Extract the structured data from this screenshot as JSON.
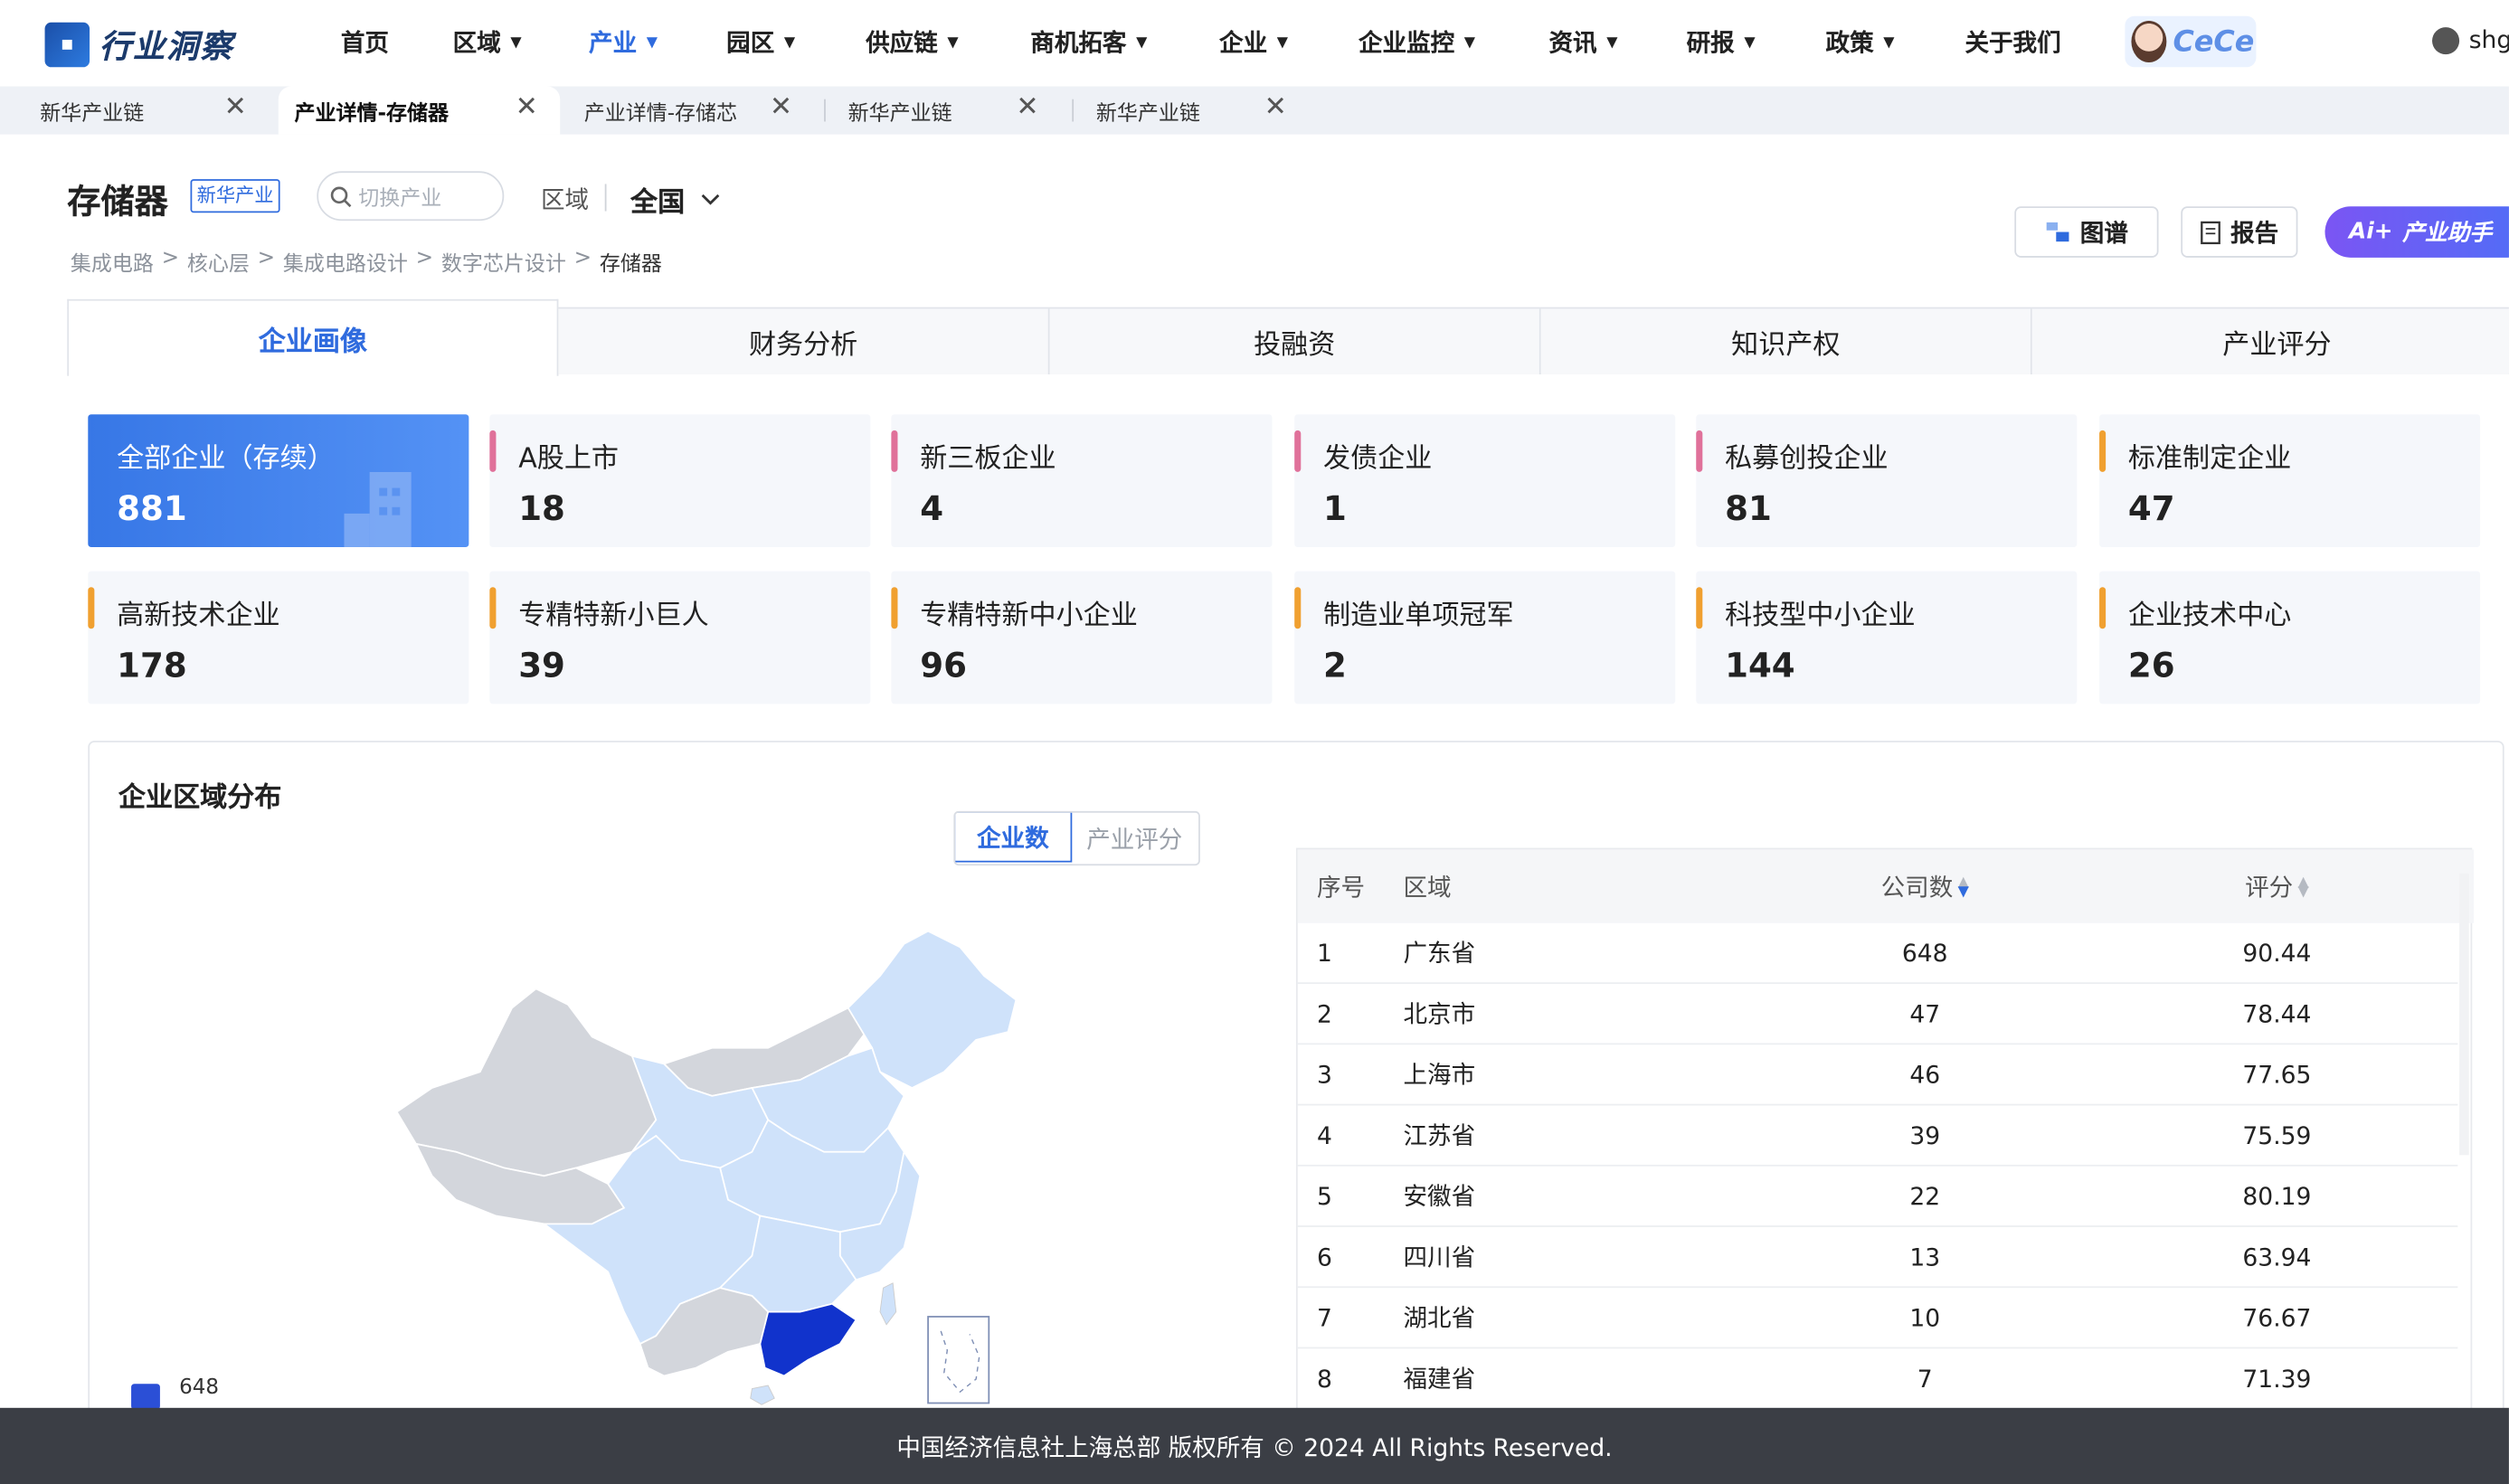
{
  "nav": {
    "logo_text": "行业洞察",
    "items": [
      {
        "label": "首页",
        "dropdown": false
      },
      {
        "label": "区域",
        "dropdown": true
      },
      {
        "label": "产业",
        "dropdown": true
      },
      {
        "label": "园区",
        "dropdown": true
      },
      {
        "label": "供应链",
        "dropdown": true
      },
      {
        "label": "商机拓客",
        "dropdown": true
      },
      {
        "label": "企业",
        "dropdown": true
      },
      {
        "label": "企业监控",
        "dropdown": true
      },
      {
        "label": "资讯",
        "dropdown": true
      },
      {
        "label": "研报",
        "dropdown": true
      },
      {
        "label": "政策",
        "dropdown": true
      },
      {
        "label": "关于我们",
        "dropdown": false
      }
    ],
    "assistant": "CeCe",
    "user": "shg"
  },
  "tabs": [
    {
      "label": "新华产业链"
    },
    {
      "label": "产业详情-存储器"
    },
    {
      "label": "产业详情-存储芯"
    },
    {
      "label": "新华产业链"
    },
    {
      "label": "新华产业链"
    }
  ],
  "header": {
    "title": "存储器",
    "badge": "新华产业",
    "search_placeholder": "切换产业",
    "region_label": "区域",
    "region_value": "全国",
    "breadcrumb": [
      "集成电路",
      "核心层",
      "集成电路设计",
      "数字芯片设计",
      "存储器"
    ],
    "btn_graph": "图谱",
    "btn_report": "报告",
    "btn_ai": "产业助手"
  },
  "main_tabs": [
    "企业画像",
    "财务分析",
    "投融资",
    "知识产权",
    "产业评分"
  ],
  "stats": [
    {
      "label": "全部企业（存续）",
      "value": "881"
    },
    {
      "label": "A股上市",
      "value": "18"
    },
    {
      "label": "新三板企业",
      "value": "4"
    },
    {
      "label": "发债企业",
      "value": "1"
    },
    {
      "label": "私募创投企业",
      "value": "81"
    },
    {
      "label": "标准制定企业",
      "value": "47"
    },
    {
      "label": "高新技术企业",
      "value": "178"
    },
    {
      "label": "专精特新小巨人",
      "value": "39"
    },
    {
      "label": "专精特新中小企业",
      "value": "96"
    },
    {
      "label": "制造业单项冠军",
      "value": "2"
    },
    {
      "label": "科技型中小企业",
      "value": "144"
    },
    {
      "label": "企业技术中心",
      "value": "26"
    }
  ],
  "colors": {
    "accent": "#2f6bde",
    "pink_bar": "#e0719a",
    "orange_bar": "#f0a030"
  },
  "distribution": {
    "title": "企业区域分布",
    "toggle": [
      "企业数",
      "产业评分"
    ],
    "legend_max": "648",
    "headers": {
      "no": "序号",
      "region": "区域",
      "count": "公司数",
      "score": "评分"
    },
    "rows": [
      {
        "no": "1",
        "region": "广东省",
        "count": "648",
        "score": "90.44"
      },
      {
        "no": "2",
        "region": "北京市",
        "count": "47",
        "score": "78.44"
      },
      {
        "no": "3",
        "region": "上海市",
        "count": "46",
        "score": "77.65"
      },
      {
        "no": "4",
        "region": "江苏省",
        "count": "39",
        "score": "75.59"
      },
      {
        "no": "5",
        "region": "安徽省",
        "count": "22",
        "score": "80.19"
      },
      {
        "no": "6",
        "region": "四川省",
        "count": "13",
        "score": "63.94"
      },
      {
        "no": "7",
        "region": "湖北省",
        "count": "10",
        "score": "76.67"
      },
      {
        "no": "8",
        "region": "福建省",
        "count": "7",
        "score": "71.39"
      }
    ]
  },
  "footer": "中国经济信息社上海总部 版权所有 © 2024 All Rights Reserved."
}
